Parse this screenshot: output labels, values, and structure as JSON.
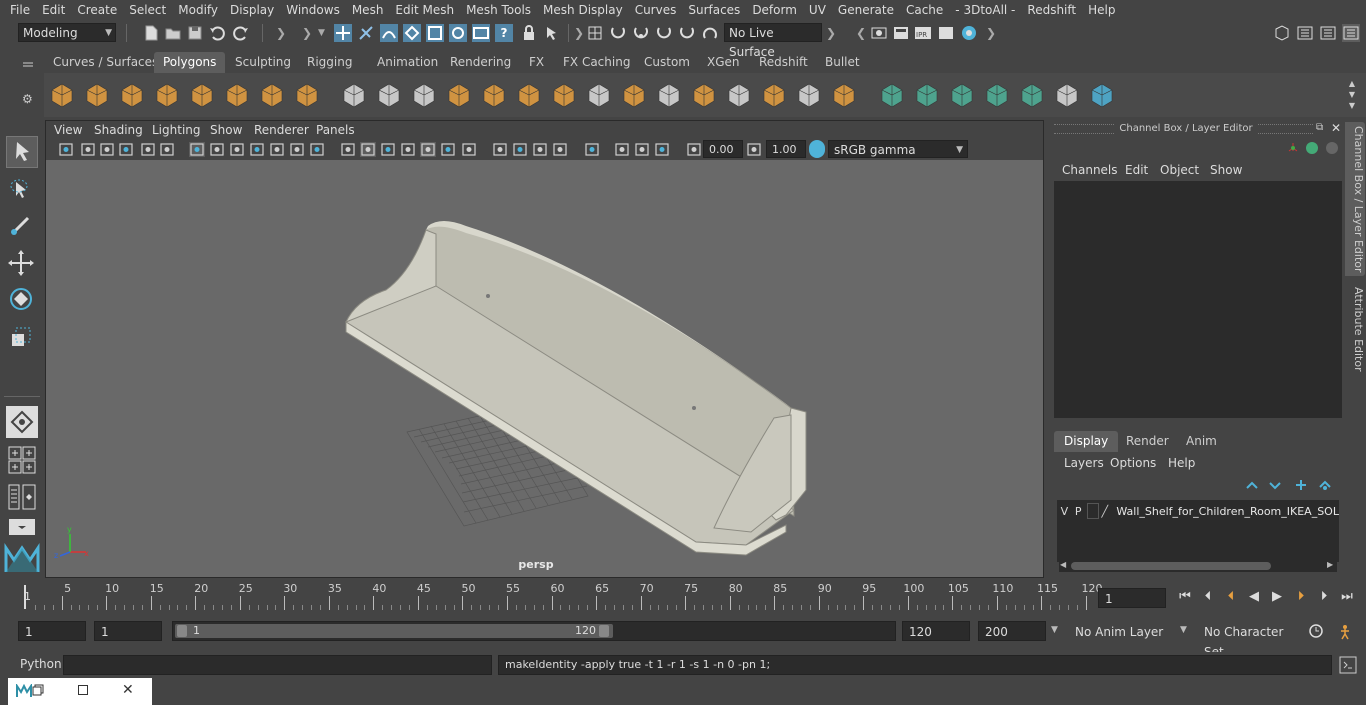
{
  "menu": [
    "File",
    "Edit",
    "Create",
    "Select",
    "Modify",
    "Display",
    "Windows",
    "Mesh",
    "Edit Mesh",
    "Mesh Tools",
    "Mesh Display",
    "Curves",
    "Surfaces",
    "Deform",
    "UV",
    "Generate",
    "Cache",
    "- 3DtoAll -",
    "Redshift",
    "Help"
  ],
  "status": {
    "mode": "Modeling",
    "live_surface": "No Live Surface"
  },
  "shelf_tabs": [
    "Curves / Surfaces",
    "Polygons",
    "Sculpting",
    "Rigging",
    "Animation",
    "Rendering",
    "FX",
    "FX Caching",
    "Custom",
    "XGen",
    "Redshift",
    "Bullet"
  ],
  "shelf_active": "Polygons",
  "viewport": {
    "menu": [
      "View",
      "Shading",
      "Lighting",
      "Show",
      "Renderer",
      "Panels"
    ],
    "exposure": "0.00",
    "gamma": "1.00",
    "colorspace": "sRGB gamma",
    "camera": "persp"
  },
  "channelbox": {
    "title": "Channel Box / Layer Editor",
    "menu": [
      "Channels",
      "Edit",
      "Object",
      "Show"
    ],
    "tabs": [
      "Display",
      "Render",
      "Anim"
    ],
    "active_tab": "Display",
    "layer_menu": [
      "Layers",
      "Options",
      "Help"
    ],
    "layer": {
      "v": "V",
      "p": "P",
      "name": "Wall_Shelf_for_Children_Room_IKEA_SOLGUL"
    }
  },
  "side_tabs": [
    "Channel Box / Layer Editor",
    "Attribute Editor"
  ],
  "timeline": {
    "ticks": [
      "5",
      "10",
      "15",
      "20",
      "25",
      "30",
      "35",
      "40",
      "45",
      "50",
      "55",
      "60",
      "65",
      "70",
      "75",
      "80",
      "85",
      "90",
      "95",
      "100",
      "105",
      "110",
      "115",
      "120"
    ],
    "start_marker": "1",
    "current_frame": "1"
  },
  "range": {
    "start": "1",
    "inner_start": "1",
    "slider_start": "1",
    "slider_end": "120",
    "end": "120",
    "outer_end": "200",
    "anim_layer": "No Anim Layer",
    "character_set": "No Character Set"
  },
  "command": {
    "lang": "Python",
    "input": "",
    "result": "makeIdentity -apply true -t 1 -r 1 -s 1 -n 0 -pn 1;"
  },
  "colors": {
    "bg": "#444444",
    "viewport": "#696969",
    "field": "#2b2b2b",
    "accent": "#5285a6",
    "active_tab": "#5d5d5d"
  }
}
